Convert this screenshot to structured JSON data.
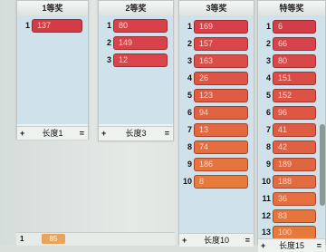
{
  "columns": [
    {
      "title": "1等奖",
      "footer_plus": "+",
      "footer_label": "长度1",
      "footer_eq": "=",
      "items": [
        {
          "index": "1",
          "value": "137",
          "color": "#d43b46"
        }
      ]
    },
    {
      "title": "2等奖",
      "footer_plus": "+",
      "footer_label": "长度3",
      "footer_eq": "=",
      "items": [
        {
          "index": "1",
          "value": "80",
          "color": "#d8414a"
        },
        {
          "index": "2",
          "value": "149",
          "color": "#d8434a"
        },
        {
          "index": "3",
          "value": "12",
          "color": "#d9454a"
        }
      ]
    },
    {
      "title": "3等奖",
      "footer_plus": "+",
      "footer_label": "长度10",
      "footer_eq": "=",
      "items": [
        {
          "index": "1",
          "value": "169",
          "color": "#d7404a"
        },
        {
          "index": "2",
          "value": "157",
          "color": "#d9474a"
        },
        {
          "index": "3",
          "value": "163",
          "color": "#db4e47"
        },
        {
          "index": "4",
          "value": "26",
          "color": "#dd5545"
        },
        {
          "index": "5",
          "value": "123",
          "color": "#df5b43"
        },
        {
          "index": "6",
          "value": "94",
          "color": "#e16241"
        },
        {
          "index": "7",
          "value": "13",
          "color": "#e3683f"
        },
        {
          "index": "8",
          "value": "74",
          "color": "#e46e3e"
        },
        {
          "index": "9",
          "value": "186",
          "color": "#e5753d"
        },
        {
          "index": "10",
          "value": "8",
          "color": "#e67b3c"
        }
      ]
    },
    {
      "title": "特等奖",
      "footer_plus": "+",
      "footer_label": "长度15",
      "footer_eq": "=",
      "items": [
        {
          "index": "1",
          "value": "6",
          "color": "#d33d48"
        },
        {
          "index": "2",
          "value": "66",
          "color": "#d6434a"
        },
        {
          "index": "3",
          "value": "80",
          "color": "#d84848"
        },
        {
          "index": "4",
          "value": "151",
          "color": "#da4d46"
        },
        {
          "index": "5",
          "value": "152",
          "color": "#dc5245"
        },
        {
          "index": "6",
          "value": "96",
          "color": "#dd5743"
        },
        {
          "index": "7",
          "value": "41",
          "color": "#df5c42"
        },
        {
          "index": "8",
          "value": "42",
          "color": "#e06141"
        },
        {
          "index": "9",
          "value": "189",
          "color": "#e16640"
        },
        {
          "index": "10",
          "value": "188",
          "color": "#e26b3f"
        },
        {
          "index": "11",
          "value": "36",
          "color": "#e3703e"
        },
        {
          "index": "12",
          "value": "83",
          "color": "#e4753d"
        },
        {
          "index": "13",
          "value": "100",
          "color": "#e57a3c"
        }
      ]
    }
  ],
  "bottom": {
    "index": "1",
    "value": "85",
    "color": "#e8a45a"
  }
}
